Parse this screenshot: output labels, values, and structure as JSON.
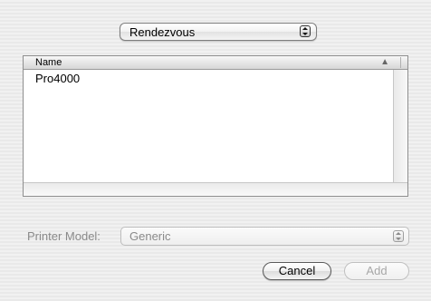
{
  "connection": {
    "selected": "Rendezvous"
  },
  "printer_list": {
    "columns": [
      {
        "label": "Name",
        "sort_indicator": "▲"
      }
    ],
    "rows": [
      {
        "name": "Pro4000"
      }
    ]
  },
  "printer_model": {
    "label": "Printer Model:",
    "selected": "Generic",
    "enabled": false
  },
  "buttons": {
    "cancel": {
      "label": "Cancel",
      "enabled": true
    },
    "add": {
      "label": "Add",
      "enabled": false
    }
  },
  "icons": {
    "popup_arrows": "up-down-arrows-icon",
    "sort": "sort-ascending-icon"
  }
}
